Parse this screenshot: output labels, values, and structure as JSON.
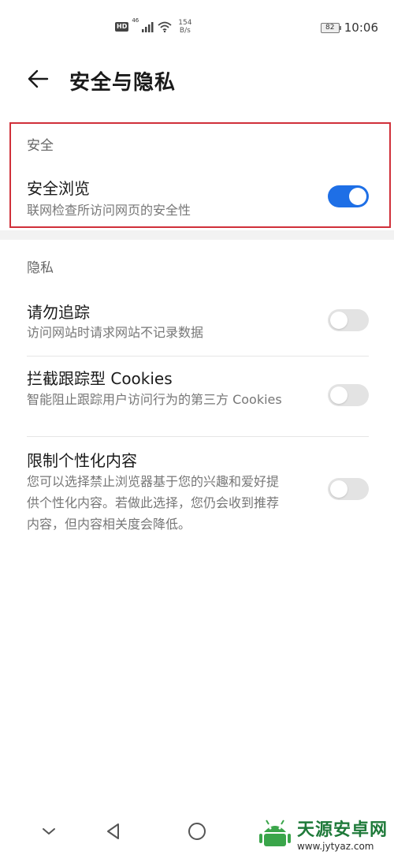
{
  "status_bar": {
    "hd_badge": "HD",
    "signal_label": "46",
    "speed_value": "154",
    "speed_unit": "B/s",
    "battery": "82",
    "time": "10:06"
  },
  "header": {
    "title": "安全与隐私"
  },
  "security": {
    "section_label": "安全",
    "safe_browsing": {
      "title": "安全浏览",
      "desc": "联网检查所访问网页的安全性",
      "enabled": true
    }
  },
  "privacy": {
    "section_label": "隐私",
    "items": [
      {
        "title": "请勿追踪",
        "desc": "访问网站时请求网站不记录数据",
        "enabled": false
      },
      {
        "title": "拦截跟踪型 Cookies",
        "desc": "智能阻止跟踪用户访问行为的第三方 Cookies",
        "enabled": false
      },
      {
        "title": "限制个性化内容",
        "desc": "您可以选择禁止浏览器基于您的兴趣和爱好提供个性化内容。若做此选择，您仍会收到推荐内容，但内容相关度会降低。",
        "enabled": false
      }
    ]
  },
  "nav_bar": {
    "buttons": [
      "collapse-icon",
      "back-icon",
      "home-icon"
    ]
  },
  "watermark": {
    "title": "天源安卓网",
    "url": "www.jytyaz.com",
    "accent": "#1f7a3a"
  },
  "colors": {
    "toggle_on": "#1e6fe6",
    "toggle_off": "#e3e3e3",
    "highlight_border": "#d0303a"
  }
}
